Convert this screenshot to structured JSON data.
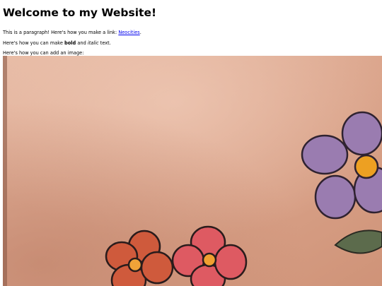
{
  "page": {
    "title": "Welcome to my Website!",
    "para1": {
      "prefix": "This is a paragraph! Here's how you make a link: ",
      "link_text": "Neocities",
      "suffix": "."
    },
    "para2": {
      "prefix": "Here's how you can make ",
      "bold": "bold",
      "middle": " and ",
      "italic": "italic",
      "suffix": " text."
    },
    "para3": "Here's how you can add an image:"
  },
  "colors": {
    "link": "#0000ee",
    "skin": "#d9a68c",
    "flower_purple": "#9b7bb0",
    "flower_red": "#d45a4a",
    "flower_pink": "#e0606a",
    "flower_center": "#f0a020",
    "leaf": "#5a6a4a"
  },
  "image": {
    "subject": "flower tattoo on skin",
    "icon": "image-photo"
  }
}
